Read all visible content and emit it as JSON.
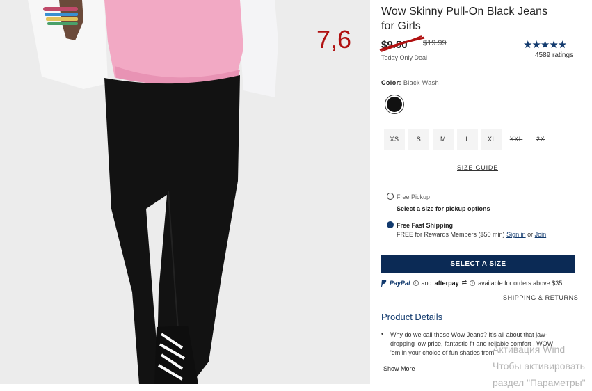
{
  "annotation": {
    "text": "7,6"
  },
  "product": {
    "title": "Wow Skinny Pull-On Black Jeans for Girls",
    "sale_price": "$9.50",
    "original_price": "$19.99",
    "deal_label": "Today Only Deal",
    "rating_stars": "★★★★★",
    "rating_value": 4.7,
    "ratings_count": "4589 ratings"
  },
  "color": {
    "label": "Color:",
    "value": "Black Wash",
    "swatch_color": "#111111"
  },
  "sizes": [
    {
      "label": "XS",
      "available": true
    },
    {
      "label": "S",
      "available": true
    },
    {
      "label": "M",
      "available": true
    },
    {
      "label": "L",
      "available": true
    },
    {
      "label": "XL",
      "available": true
    },
    {
      "label": "XXL",
      "available": false
    },
    {
      "label": "2X",
      "available": false
    }
  ],
  "size_guide": "SIZE GUIDE",
  "fulfillment": {
    "pickup_label": "Free Pickup",
    "pickup_sub": "Select a size for pickup options",
    "shipping_label": "Free Fast Shipping",
    "shipping_sub": "FREE for Rewards Members ($50 min)",
    "sign_in": "Sign in",
    "or": "or",
    "join": "Join"
  },
  "cta": {
    "label": "SELECT A SIZE"
  },
  "payments": {
    "paypal": "PayPal",
    "and": "and",
    "afterpay": "afterpay",
    "note": "available for orders above $35"
  },
  "shipping_returns": "SHIPPING & RETURNS",
  "details": {
    "heading": "Product Details",
    "bullet": "•",
    "text": "Why do we call these Wow Jeans? It's all about that jaw-dropping low price, fantastic fit and reliable comfort . WOW 'em in your choice of fun shades from",
    "show_more": "Show More"
  },
  "watermark": {
    "line1": "Активация Wind",
    "line2": "Чтобы активировать",
    "line3": "раздел \"Параметры\""
  },
  "colors": {
    "brand_navy": "#0b2a55",
    "annotation_red": "#b01010",
    "sweater_pink": "#f2a9c4"
  }
}
